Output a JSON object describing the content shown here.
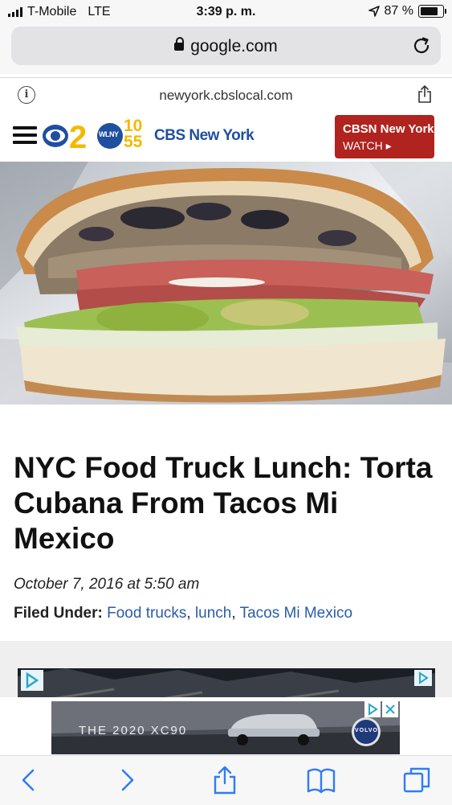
{
  "status_bar": {
    "carrier": "T-Mobile",
    "network": "LTE",
    "time": "3:39 p. m.",
    "battery": "87 %",
    "battery_level": 0.87
  },
  "browser": {
    "domain": "google.com",
    "site": "newyork.cbslocal.com"
  },
  "site_header": {
    "brand": "CBS New York",
    "logo_text": {
      "wlny": "WLNY",
      "num_top": "10",
      "num_bottom": "55"
    },
    "cbsn_title": "CBSN New York",
    "cbsn_watch": "WATCH ▸"
  },
  "article": {
    "title": "NYC Food Truck Lunch: Torta Cubana From Tacos Mi Mexico",
    "date": "October 7, 2016 at 5:50 am",
    "filed_label": "Filed Under:",
    "tags": [
      "Food trucks",
      "lunch",
      "Tacos Mi Mexico"
    ]
  },
  "ad": {
    "text": "THE 2020 XC90",
    "badge": "VOLVO"
  },
  "colors": {
    "cbsn_red": "#b0231e",
    "link_blue": "#2a5ca8",
    "safari_blue": "#2f7cf6"
  }
}
